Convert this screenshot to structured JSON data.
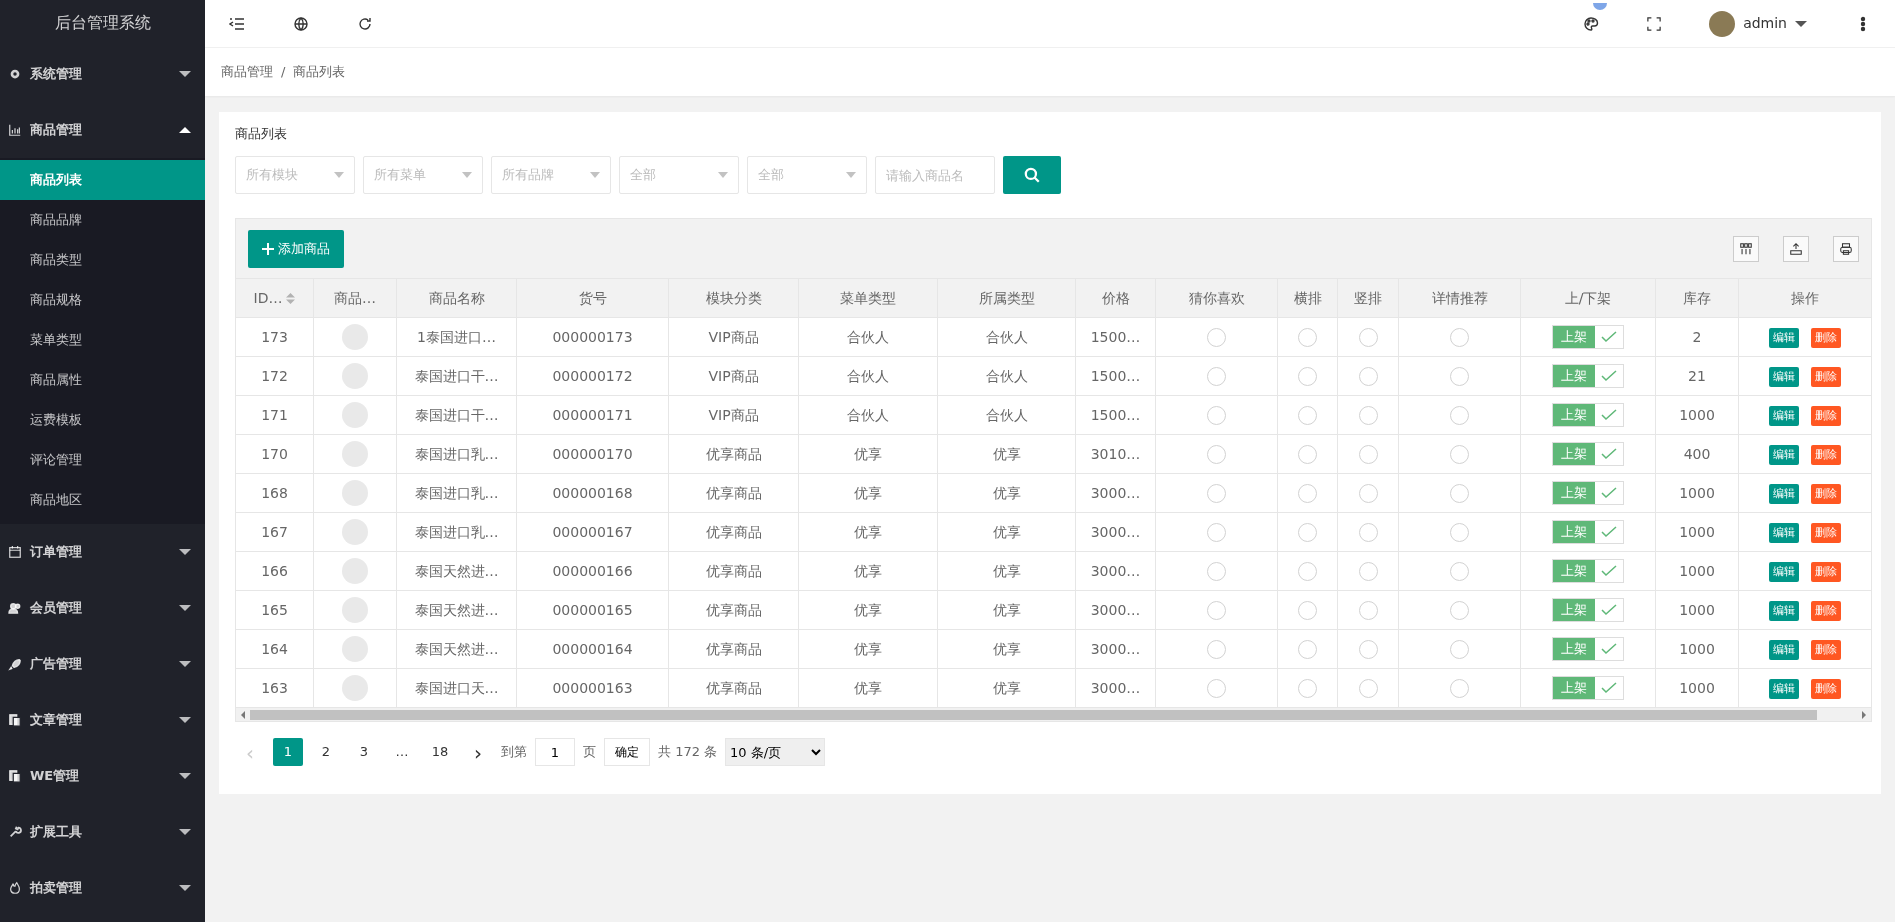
{
  "sidebar": {
    "title": "后台管理系统",
    "items": [
      {
        "label": "系统管理",
        "expanded": false
      },
      {
        "label": "商品管理",
        "expanded": true,
        "children": [
          {
            "label": "商品列表",
            "selected": true
          },
          {
            "label": "商品品牌",
            "selected": false
          },
          {
            "label": "商品类型",
            "selected": false
          },
          {
            "label": "商品规格",
            "selected": false
          },
          {
            "label": "菜单类型",
            "selected": false
          },
          {
            "label": "商品属性",
            "selected": false
          },
          {
            "label": "运费模板",
            "selected": false
          },
          {
            "label": "评论管理",
            "selected": false
          },
          {
            "label": "商品地区",
            "selected": false
          }
        ]
      },
      {
        "label": "订单管理",
        "expanded": false
      },
      {
        "label": "会员管理",
        "expanded": false
      },
      {
        "label": "广告管理",
        "expanded": false
      },
      {
        "label": "文章管理",
        "expanded": false
      },
      {
        "label": "WE管理",
        "expanded": false
      },
      {
        "label": "扩展工具",
        "expanded": false
      },
      {
        "label": "拍卖管理",
        "expanded": false
      }
    ]
  },
  "topbar": {
    "user": "admin"
  },
  "breadcrumb": {
    "items": [
      "商品管理",
      "商品列表"
    ],
    "separator": "/"
  },
  "panel_title": "商品列表",
  "filters": [
    {
      "placeholder": "所有模块"
    },
    {
      "placeholder": "所有菜单"
    },
    {
      "placeholder": "所有品牌"
    },
    {
      "placeholder": "全部"
    },
    {
      "placeholder": "全部"
    }
  ],
  "search": {
    "placeholder": "请输入商品名"
  },
  "add_button": "添加商品",
  "table": {
    "columns": [
      {
        "label": "ID…",
        "sortable": true
      },
      {
        "label": "商品…",
        "sortable": false
      },
      {
        "label": "商品名称",
        "sortable": false
      },
      {
        "label": "货号",
        "sortable": false
      },
      {
        "label": "模块分类",
        "sortable": false
      },
      {
        "label": "菜单类型",
        "sortable": false
      },
      {
        "label": "所属类型",
        "sortable": false
      },
      {
        "label": "价格",
        "sortable": false
      },
      {
        "label": "猜你喜欢",
        "sortable": false
      },
      {
        "label": "横排",
        "sortable": false
      },
      {
        "label": "竖排",
        "sortable": false
      },
      {
        "label": "详情推荐",
        "sortable": false
      },
      {
        "label": "上/下架",
        "sortable": false
      },
      {
        "label": "库存",
        "sortable": false
      },
      {
        "label": "操作",
        "sortable": false
      }
    ],
    "rows": [
      {
        "id": "173",
        "name": "1泰国进口…",
        "code": "000000173",
        "module": "VIP商品",
        "menu": "合伙人",
        "category": "合伙人",
        "price": "1500…",
        "guess_like": false,
        "horizontal": false,
        "vertical": false,
        "detail_recommend": false,
        "shelf": {
          "label": "上架",
          "on": true
        },
        "stock": "2",
        "edit": "编辑",
        "delete": "删除"
      },
      {
        "id": "172",
        "name": "泰国进口干…",
        "code": "000000172",
        "module": "VIP商品",
        "menu": "合伙人",
        "category": "合伙人",
        "price": "1500…",
        "guess_like": false,
        "horizontal": false,
        "vertical": false,
        "detail_recommend": false,
        "shelf": {
          "label": "上架",
          "on": true
        },
        "stock": "21",
        "edit": "编辑",
        "delete": "删除"
      },
      {
        "id": "171",
        "name": "泰国进口干…",
        "code": "000000171",
        "module": "VIP商品",
        "menu": "合伙人",
        "category": "合伙人",
        "price": "1500…",
        "guess_like": false,
        "horizontal": false,
        "vertical": false,
        "detail_recommend": false,
        "shelf": {
          "label": "上架",
          "on": true
        },
        "stock": "1000",
        "edit": "编辑",
        "delete": "删除"
      },
      {
        "id": "170",
        "name": "泰国进口乳…",
        "code": "000000170",
        "module": "优享商品",
        "menu": "优享",
        "category": "优享",
        "price": "3010…",
        "guess_like": false,
        "horizontal": false,
        "vertical": false,
        "detail_recommend": false,
        "shelf": {
          "label": "上架",
          "on": true
        },
        "stock": "400",
        "edit": "编辑",
        "delete": "删除"
      },
      {
        "id": "168",
        "name": "泰国进口乳…",
        "code": "000000168",
        "module": "优享商品",
        "menu": "优享",
        "category": "优享",
        "price": "3000…",
        "guess_like": false,
        "horizontal": false,
        "vertical": false,
        "detail_recommend": false,
        "shelf": {
          "label": "上架",
          "on": true
        },
        "stock": "1000",
        "edit": "编辑",
        "delete": "删除"
      },
      {
        "id": "167",
        "name": "泰国进口乳…",
        "code": "000000167",
        "module": "优享商品",
        "menu": "优享",
        "category": "优享",
        "price": "3000…",
        "guess_like": false,
        "horizontal": false,
        "vertical": false,
        "detail_recommend": false,
        "shelf": {
          "label": "上架",
          "on": true
        },
        "stock": "1000",
        "edit": "编辑",
        "delete": "删除"
      },
      {
        "id": "166",
        "name": "泰国天然进…",
        "code": "000000166",
        "module": "优享商品",
        "menu": "优享",
        "category": "优享",
        "price": "3000…",
        "guess_like": false,
        "horizontal": false,
        "vertical": false,
        "detail_recommend": false,
        "shelf": {
          "label": "上架",
          "on": true
        },
        "stock": "1000",
        "edit": "编辑",
        "delete": "删除"
      },
      {
        "id": "165",
        "name": "泰国天然进…",
        "code": "000000165",
        "module": "优享商品",
        "menu": "优享",
        "category": "优享",
        "price": "3000…",
        "guess_like": false,
        "horizontal": false,
        "vertical": false,
        "detail_recommend": false,
        "shelf": {
          "label": "上架",
          "on": true
        },
        "stock": "1000",
        "edit": "编辑",
        "delete": "删除"
      },
      {
        "id": "164",
        "name": "泰国天然进…",
        "code": "000000164",
        "module": "优享商品",
        "menu": "优享",
        "category": "优享",
        "price": "3000…",
        "guess_like": false,
        "horizontal": false,
        "vertical": false,
        "detail_recommend": false,
        "shelf": {
          "label": "上架",
          "on": true
        },
        "stock": "1000",
        "edit": "编辑",
        "delete": "删除"
      },
      {
        "id": "163",
        "name": "泰国进口天…",
        "code": "000000163",
        "module": "优享商品",
        "menu": "优享",
        "category": "优享",
        "price": "3000…",
        "guess_like": false,
        "horizontal": false,
        "vertical": false,
        "detail_recommend": false,
        "shelf": {
          "label": "上架",
          "on": true
        },
        "stock": "1000",
        "edit": "编辑",
        "delete": "删除"
      }
    ]
  },
  "pagination": {
    "prev": "‹",
    "pages": [
      {
        "label": "1",
        "selected": true
      },
      {
        "label": "2",
        "selected": false
      },
      {
        "label": "3",
        "selected": false
      },
      {
        "label": "…",
        "selected": false
      },
      {
        "label": "18",
        "selected": false
      }
    ],
    "next": "›",
    "goto_label": "到第",
    "goto_value": "1",
    "page_unit": "页",
    "confirm": "确定",
    "total": "共 172 条",
    "page_size": "10 条/页"
  }
}
